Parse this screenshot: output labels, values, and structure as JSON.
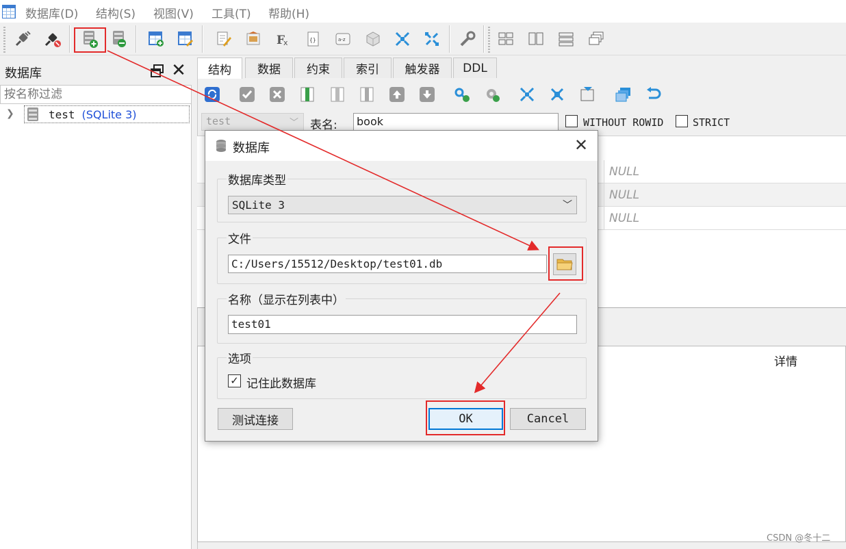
{
  "menu": {
    "items": [
      "数据库(D)",
      "结构(S)",
      "视图(V)",
      "工具(T)",
      "帮助(H)"
    ]
  },
  "db_dock": {
    "title": "数据库",
    "filter_placeholder": "按名称过滤",
    "tree": [
      {
        "name": "test",
        "type": "(SQLite 3)"
      }
    ]
  },
  "tabs": [
    "结构",
    "数据",
    "约束",
    "索引",
    "触发器",
    "DDL"
  ],
  "structure": {
    "table_type": "test",
    "table_name_label": "表名:",
    "table_name": "book",
    "without_rowid_label": "WITHOUT ROWID",
    "strict_label": "STRICT",
    "null_values": [
      "NULL",
      "NULL",
      "NULL"
    ]
  },
  "lower": {
    "details_header": "详情"
  },
  "dialog": {
    "title": "数据库",
    "db_type_group": "数据库类型",
    "db_type_value": "SQLite 3",
    "file_group": "文件",
    "file_path": "C:/Users/15512/Desktop/test01.db",
    "name_group": "名称（显示在列表中）",
    "name_value": "test01",
    "options_group": "选项",
    "remember_label": "记住此数据库",
    "remember_checked": true,
    "test_button": "测试连接",
    "ok_button": "OK",
    "cancel_button": "Cancel"
  },
  "watermark": "CSDN @冬十二",
  "colors": {
    "annotation_red": "#e32a2a",
    "sqlite_type_blue": "#1e4fd8",
    "focus_blue": "#0078d7"
  }
}
